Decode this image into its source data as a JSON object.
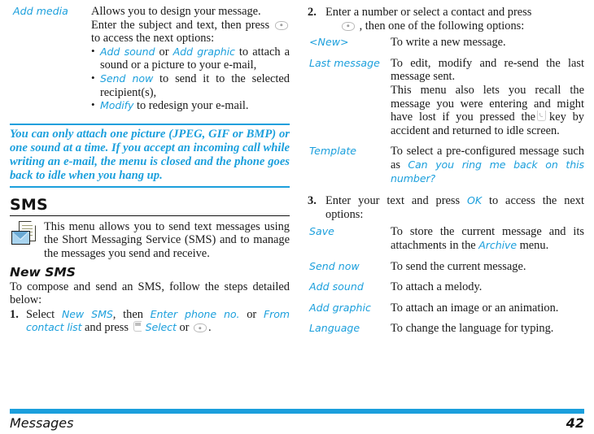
{
  "accent_color": "#1b9fdc",
  "left_column": {
    "add_media_row": {
      "term": "Add media",
      "line1": "Allows you to design your message.",
      "line2_before_key": "Enter the subject and text, then press",
      "key_icon": "center-select-key-icon",
      "line2_after_key": "to access the next options:",
      "bullets": [
        {
          "kw1": "Add sound",
          "mid": " or ",
          "kw2": "Add graphic",
          "rest": " to attach a sound or a picture to your e-mail,"
        },
        {
          "kw1": "Send now",
          "mid": "",
          "kw2": "",
          "rest": " to send it to the selected recipient(s),"
        },
        {
          "kw1": "Modify",
          "mid": "",
          "kw2": "",
          "rest": " to redesign your e-mail."
        }
      ]
    },
    "note": "You can only attach one picture (JPEG, GIF or BMP) or one sound at a time. If you accept an incoming call while writing an e-mail, the menu is closed and the phone goes back to idle when you hang up.",
    "sms_heading": "SMS",
    "sms_icon": "sms-document-envelope-icon",
    "sms_intro": "This menu allows you to send text messages using the Short Messaging Service (SMS) and to manage the messages you send and receive.",
    "new_sms_heading": "New SMS",
    "new_sms_intro": "To compose and send an SMS, follow the steps detailed below:",
    "step1": {
      "num": "1.",
      "p1": "Select ",
      "kw1": "New SMS",
      "p2": ", then ",
      "kw2": "Enter phone no.",
      "p3": " or ",
      "kw3": "From contact list",
      "p4": " and press ",
      "softkey_icon": "left-softkey-icon",
      "kw4": "Select",
      "p5": " or ",
      "center_key_icon": "center-select-key-icon",
      "p6": "."
    }
  },
  "right_column": {
    "step2": {
      "num": "2.",
      "p1": "Enter a number or select a contact and press",
      "key_icon": "center-select-key-icon",
      "p2": ", then one of the following options:"
    },
    "options_table_1": [
      {
        "term": "<New>",
        "desc": "To write a new message."
      },
      {
        "term": "Last message",
        "desc_line1": "To edit, modify and re-send the last message sent.",
        "desc_line2_a": "This menu also lets you recall the message you were entering and might have lost if you pressed the",
        "hangup_key_icon": "hangup-key-icon",
        "desc_line2_b": "key by accident and returned to idle screen."
      },
      {
        "term": "Template",
        "desc_a": "To select a pre-configured message such as ",
        "desc_kw": "Can you ring me back on this number?"
      }
    ],
    "step3": {
      "num": "3.",
      "p1": "Enter your text and press ",
      "kw": "OK",
      "p2": " to access the next options:"
    },
    "options_table_2": [
      {
        "term": "Save",
        "desc_a": "To store the current message and its attachments in the ",
        "desc_kw": "Archive",
        "desc_b": " menu."
      },
      {
        "term": "Send now",
        "desc_a": "To send the current message.",
        "desc_kw": "",
        "desc_b": ""
      },
      {
        "term": "Add sound",
        "desc_a": "To attach a melody.",
        "desc_kw": "",
        "desc_b": ""
      },
      {
        "term": "Add graphic",
        "desc_a": "To attach an image or an animation.",
        "desc_kw": "",
        "desc_b": ""
      },
      {
        "term": "Language",
        "desc_a": "To change the language for typing.",
        "desc_kw": "",
        "desc_b": ""
      }
    ]
  },
  "footer": {
    "section": "Messages",
    "page": "42"
  }
}
